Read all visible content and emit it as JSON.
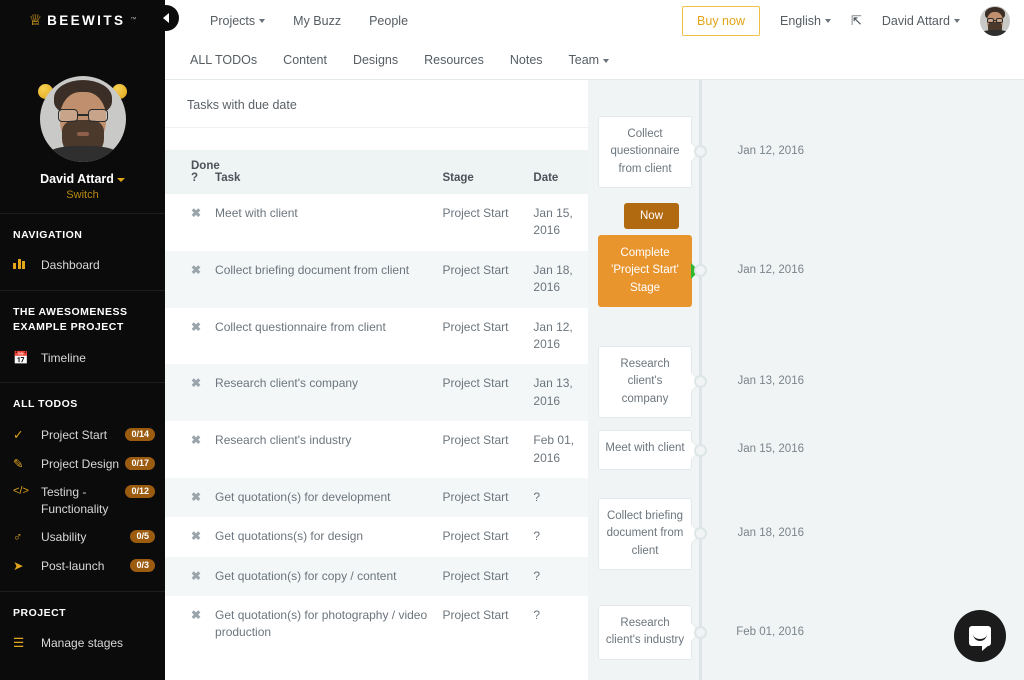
{
  "brand": {
    "logo_text": "BEEWITS",
    "logo_tm": "™",
    "crown_icon": "crown-icon"
  },
  "sidebar": {
    "user": {
      "name": "David Attard",
      "switch_label": "Switch"
    },
    "sections": [
      {
        "heading": "NAVIGATION",
        "items": [
          {
            "icon": "bar-chart-icon",
            "label": "Dashboard",
            "badge": ""
          }
        ]
      },
      {
        "heading": "THE AWESOMENESS EXAMPLE PROJECT",
        "items": [
          {
            "icon": "calendar-icon",
            "label": "Timeline",
            "badge": ""
          }
        ]
      },
      {
        "heading": "ALL TODOS",
        "items": [
          {
            "icon": "check-icon",
            "label": "Project Start",
            "badge": "0/14"
          },
          {
            "icon": "pencil-icon",
            "label": "Project Design",
            "badge": "0/17"
          },
          {
            "icon": "code-icon",
            "label": "Testing - Functionality",
            "badge": "0/12"
          },
          {
            "icon": "person-icon",
            "label": "Usability",
            "badge": "0/5"
          },
          {
            "icon": "rocket-icon",
            "label": "Post-launch",
            "badge": "0/3"
          }
        ]
      },
      {
        "heading": "PROJECT",
        "items": [
          {
            "icon": "list-icon",
            "label": "Manage stages",
            "badge": ""
          }
        ]
      }
    ]
  },
  "topbar": {
    "collapse_icon": "chevron-left-icon",
    "nav": [
      {
        "label": "Projects",
        "caret": true
      },
      {
        "label": "My Buzz",
        "caret": false
      },
      {
        "label": "People",
        "caret": false
      }
    ],
    "buy_now_label": "Buy now",
    "language": "English",
    "expand_icon": "expand-icon",
    "user_name": "David Attard",
    "avatar": "user-avatar"
  },
  "subnav": {
    "items": [
      {
        "label": "ALL TODOs",
        "caret": false
      },
      {
        "label": "Content",
        "caret": false
      },
      {
        "label": "Designs",
        "caret": false
      },
      {
        "label": "Resources",
        "caret": false
      },
      {
        "label": "Notes",
        "caret": false
      },
      {
        "label": "Team",
        "caret": true
      }
    ]
  },
  "tasks_panel": {
    "title": "Tasks with due date",
    "columns": [
      "Done ?",
      "Task",
      "Stage",
      "Date"
    ],
    "column_done_line1": "Done",
    "column_done_line2": "?",
    "column_task": "Task",
    "column_stage": "Stage",
    "column_date": "Date",
    "done_mark": "✖",
    "rows": [
      {
        "done": "✖",
        "task": "Meet with client",
        "stage": "Project Start",
        "date": "Jan 15, 2016"
      },
      {
        "done": "✖",
        "task": "Collect briefing document from client",
        "stage": "Project Start",
        "date": "Jan 18, 2016"
      },
      {
        "done": "✖",
        "task": "Collect questionnaire from client",
        "stage": "Project Start",
        "date": "Jan 12, 2016"
      },
      {
        "done": "✖",
        "task": "Research client's company",
        "stage": "Project Start",
        "date": "Jan 13, 2016"
      },
      {
        "done": "✖",
        "task": "Research client's industry",
        "stage": "Project Start",
        "date": "Feb 01, 2016"
      },
      {
        "done": "✖",
        "task": "Get quotation(s) for development",
        "stage": "Project Start",
        "date": "?"
      },
      {
        "done": "✖",
        "task": "Get quotations(s) for design",
        "stage": "Project Start",
        "date": "?"
      },
      {
        "done": "✖",
        "task": "Get quotation(s) for copy / content",
        "stage": "Project Start",
        "date": "?"
      },
      {
        "done": "✖",
        "task": "Get quotation(s) for photography / video production",
        "stage": "Project Start",
        "date": "?"
      }
    ]
  },
  "timeline": {
    "now_label": "Now",
    "items": [
      {
        "label": "Collect questionnaire from client",
        "date": "Jan 12, 2016",
        "accent": false
      },
      {
        "label": "Complete 'Project Start' Stage",
        "date": "Jan 12, 2016",
        "accent": true
      },
      {
        "label": "Research client's company",
        "date": "Jan 13, 2016",
        "accent": false
      },
      {
        "label": "Meet with client",
        "date": "Jan 15, 2016",
        "accent": false
      },
      {
        "label": "Collect briefing document from client",
        "date": "Jan 18, 2016",
        "accent": false
      },
      {
        "label": "Research client's industry",
        "date": "Feb 01, 2016",
        "accent": false
      }
    ]
  },
  "support": {
    "icon": "intercom-chat-icon"
  },
  "colors": {
    "accent_orange": "#e8952e",
    "badge_brown": "#9c5c10",
    "now_brown": "#b26a10",
    "brand_yellow": "#e0a419",
    "sidebar_bg": "#0b0b0b",
    "page_bg": "#f0f4f5",
    "arrow_green": "#2eb82e"
  }
}
